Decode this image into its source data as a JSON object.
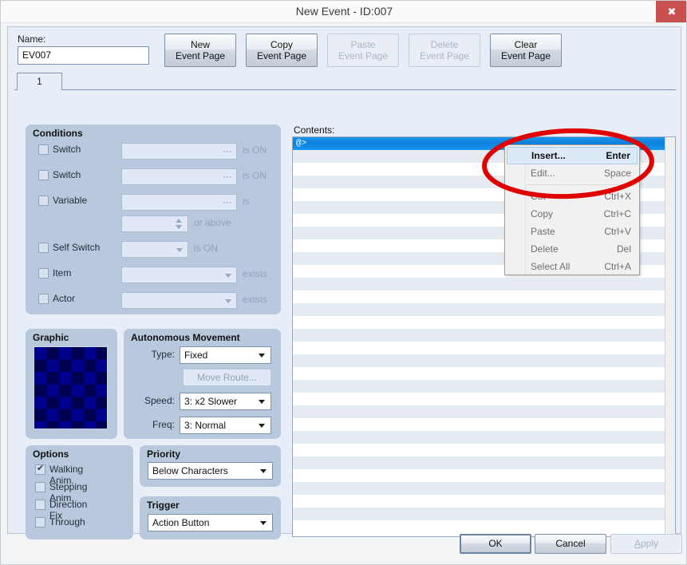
{
  "window": {
    "title": "New Event - ID:007",
    "close_label": "✖"
  },
  "header": {
    "name_label": "Name:",
    "name_value": "EV007",
    "buttons": [
      {
        "label": "New\nEvent Page",
        "enabled": true
      },
      {
        "label": "Copy\nEvent Page",
        "enabled": true
      },
      {
        "label": "Paste\nEvent Page",
        "enabled": false
      },
      {
        "label": "Delete\nEvent Page",
        "enabled": false
      },
      {
        "label": "Clear\nEvent Page",
        "enabled": true
      }
    ]
  },
  "tabs": [
    {
      "label": "1",
      "active": true
    }
  ],
  "conditions": {
    "title": "Conditions",
    "rows": [
      {
        "label": "Switch",
        "checked": false,
        "field": "",
        "suffix": "is ON"
      },
      {
        "label": "Switch",
        "checked": false,
        "field": "",
        "suffix": "is ON"
      },
      {
        "label": "Variable",
        "checked": false,
        "field": "",
        "suffix": "is"
      },
      {
        "label": "",
        "checked": null,
        "field": "",
        "suffix": "or above"
      },
      {
        "label": "Self Switch",
        "checked": false,
        "field": "",
        "suffix": "is ON"
      },
      {
        "label": "Item",
        "checked": false,
        "field": "",
        "suffix": "exists"
      },
      {
        "label": "Actor",
        "checked": false,
        "field": "",
        "suffix": "exists"
      }
    ]
  },
  "graphic": {
    "title": "Graphic"
  },
  "movement": {
    "title": "Autonomous Movement",
    "type_label": "Type:",
    "type_value": "Fixed",
    "move_route_label": "Move Route...",
    "speed_label": "Speed:",
    "speed_value": "3: x2 Slower",
    "freq_label": "Freq:",
    "freq_value": "3: Normal"
  },
  "options": {
    "title": "Options",
    "items": [
      {
        "label": "Walking Anim.",
        "checked": true
      },
      {
        "label": "Stepping Anim.",
        "checked": false
      },
      {
        "label": "Direction Fix",
        "checked": false
      },
      {
        "label": "Through",
        "checked": false
      }
    ]
  },
  "priority": {
    "title": "Priority",
    "value": "Below Characters"
  },
  "trigger": {
    "title": "Trigger",
    "value": "Action Button"
  },
  "contents": {
    "label": "Contents:",
    "selected_row_text": "@>",
    "row_count": 31
  },
  "context_menu": {
    "items": [
      {
        "label": "Insert...",
        "accel": "Enter",
        "enabled": true,
        "highlight": true
      },
      {
        "label": "Edit...",
        "accel": "Space",
        "enabled": false,
        "highlight": false
      },
      {
        "separator": true
      },
      {
        "label": "Cut",
        "accel": "Ctrl+X",
        "enabled": false,
        "highlight": false
      },
      {
        "label": "Copy",
        "accel": "Ctrl+C",
        "enabled": false,
        "highlight": false
      },
      {
        "label": "Paste",
        "accel": "Ctrl+V",
        "enabled": false,
        "highlight": false
      },
      {
        "label": "Delete",
        "accel": "Del",
        "enabled": false,
        "highlight": false
      },
      {
        "label": "Select All",
        "accel": "Ctrl+A",
        "enabled": false,
        "highlight": false
      }
    ]
  },
  "annotation": {
    "shape": "ellipse",
    "color": "#e00000"
  },
  "footer": {
    "ok_label": "OK",
    "cancel_label": "Cancel",
    "apply_label": "Apply",
    "apply_enabled": false
  },
  "colors": {
    "accent": "#0c7fd6",
    "panel": "#b9c9dd",
    "dialog_bg": "#e8eef7",
    "close_btn": "#c8504f",
    "annotation": "#e00000"
  }
}
